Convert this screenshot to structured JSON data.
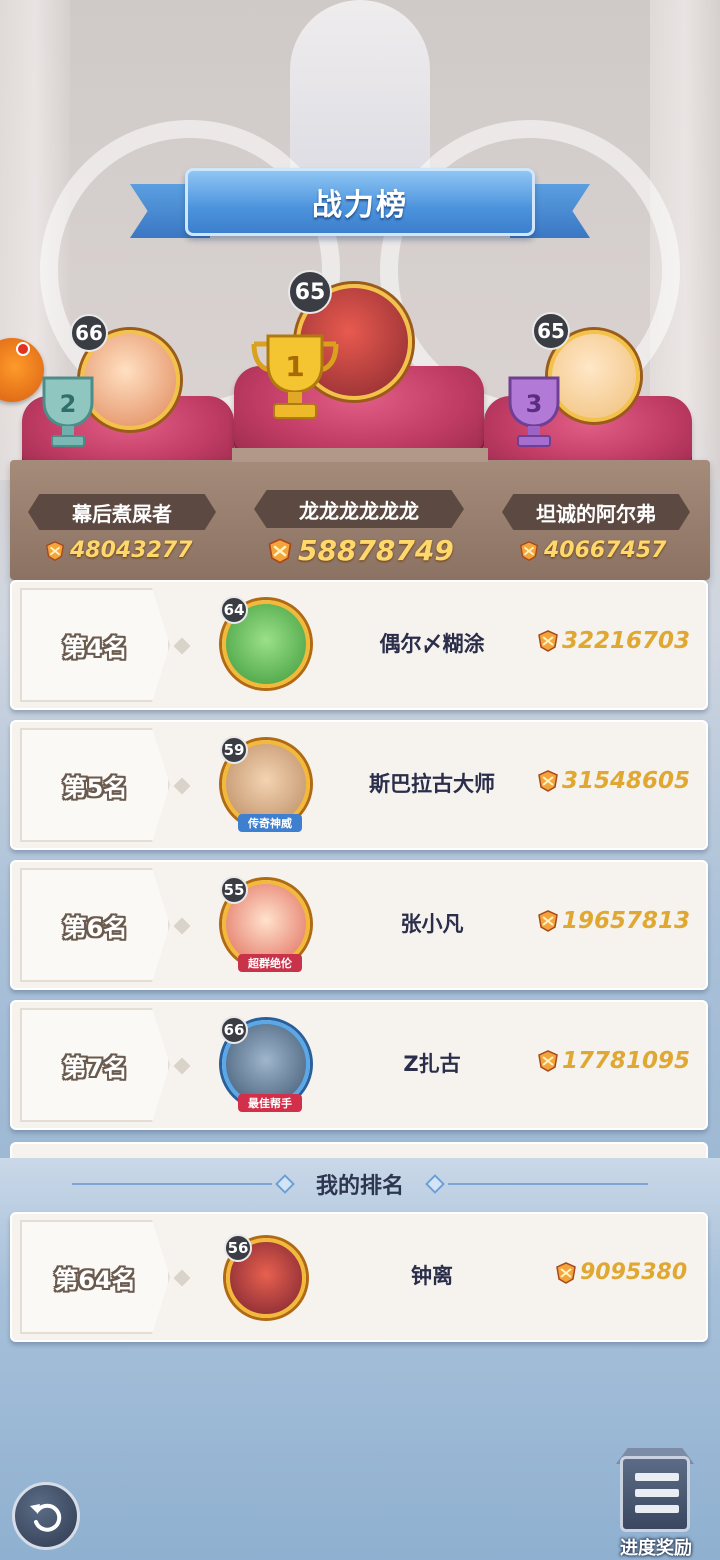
{
  "title": "战力榜",
  "top3": [
    {
      "rank": 2,
      "name": "幕后煮屎者",
      "score": "48043277",
      "level": "66"
    },
    {
      "rank": 1,
      "name": "龙龙龙龙龙龙",
      "score": "58878749",
      "level": "65"
    },
    {
      "rank": 3,
      "name": "坦诚的阿尔弗",
      "score": "40667457",
      "level": "65"
    }
  ],
  "rows": [
    {
      "rank_label": "第4名",
      "name": "偶尔〆糊涂",
      "score": "32216703",
      "level": "64",
      "tag": ""
    },
    {
      "rank_label": "第5名",
      "name": "斯巴拉古大师",
      "score": "31548605",
      "level": "59",
      "tag": "传奇神威"
    },
    {
      "rank_label": "第6名",
      "name": "张小凡",
      "score": "19657813",
      "level": "55",
      "tag": "超群绝伦"
    },
    {
      "rank_label": "第7名",
      "name": "Z扎古",
      "score": "17781095",
      "level": "66",
      "tag": "最佳帮手"
    }
  ],
  "my": {
    "header": "我的排名",
    "rank_label": "第64名",
    "name": "钟离",
    "score": "9095380",
    "level": "56"
  },
  "buttons": {
    "back_icon": "undo-arrow-icon",
    "progress_label": "进度奖励"
  },
  "colors": {
    "gold": "#e0a832",
    "podium": "#8c7262",
    "cushion": "#c23d66",
    "banner": "#4c93dd"
  }
}
